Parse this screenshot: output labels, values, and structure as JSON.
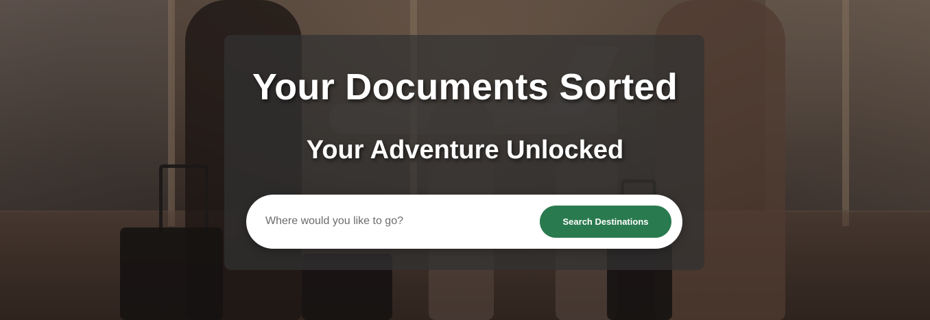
{
  "hero": {
    "title": "Your Documents Sorted",
    "subtitle": "Your Adventure Unlocked",
    "background_image": "family-with-luggage-at-airport-photo"
  },
  "search": {
    "placeholder": "Where would you like to go?",
    "value": "",
    "button_label": "Search Destinations"
  },
  "colors": {
    "accent": "#2a7a4f",
    "panel": "#323232",
    "text": "#ffffff"
  }
}
